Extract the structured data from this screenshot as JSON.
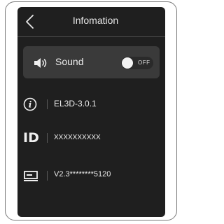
{
  "header": {
    "title": "Infomation"
  },
  "sound": {
    "label": "Sound",
    "toggle_state": "OFF",
    "enabled": false
  },
  "info_rows": [
    {
      "icon": "info-icon",
      "value": "EL3D-3.0.1"
    },
    {
      "icon": "id-icon",
      "icon_text": "ID",
      "value": "XXXXXXXXXX"
    },
    {
      "icon": "device-icon",
      "value": "V2.3********5120"
    }
  ],
  "colors": {
    "screen_bg": "#1f1f1f",
    "card_bg": "#3a3a3a",
    "text": "#ececec"
  }
}
